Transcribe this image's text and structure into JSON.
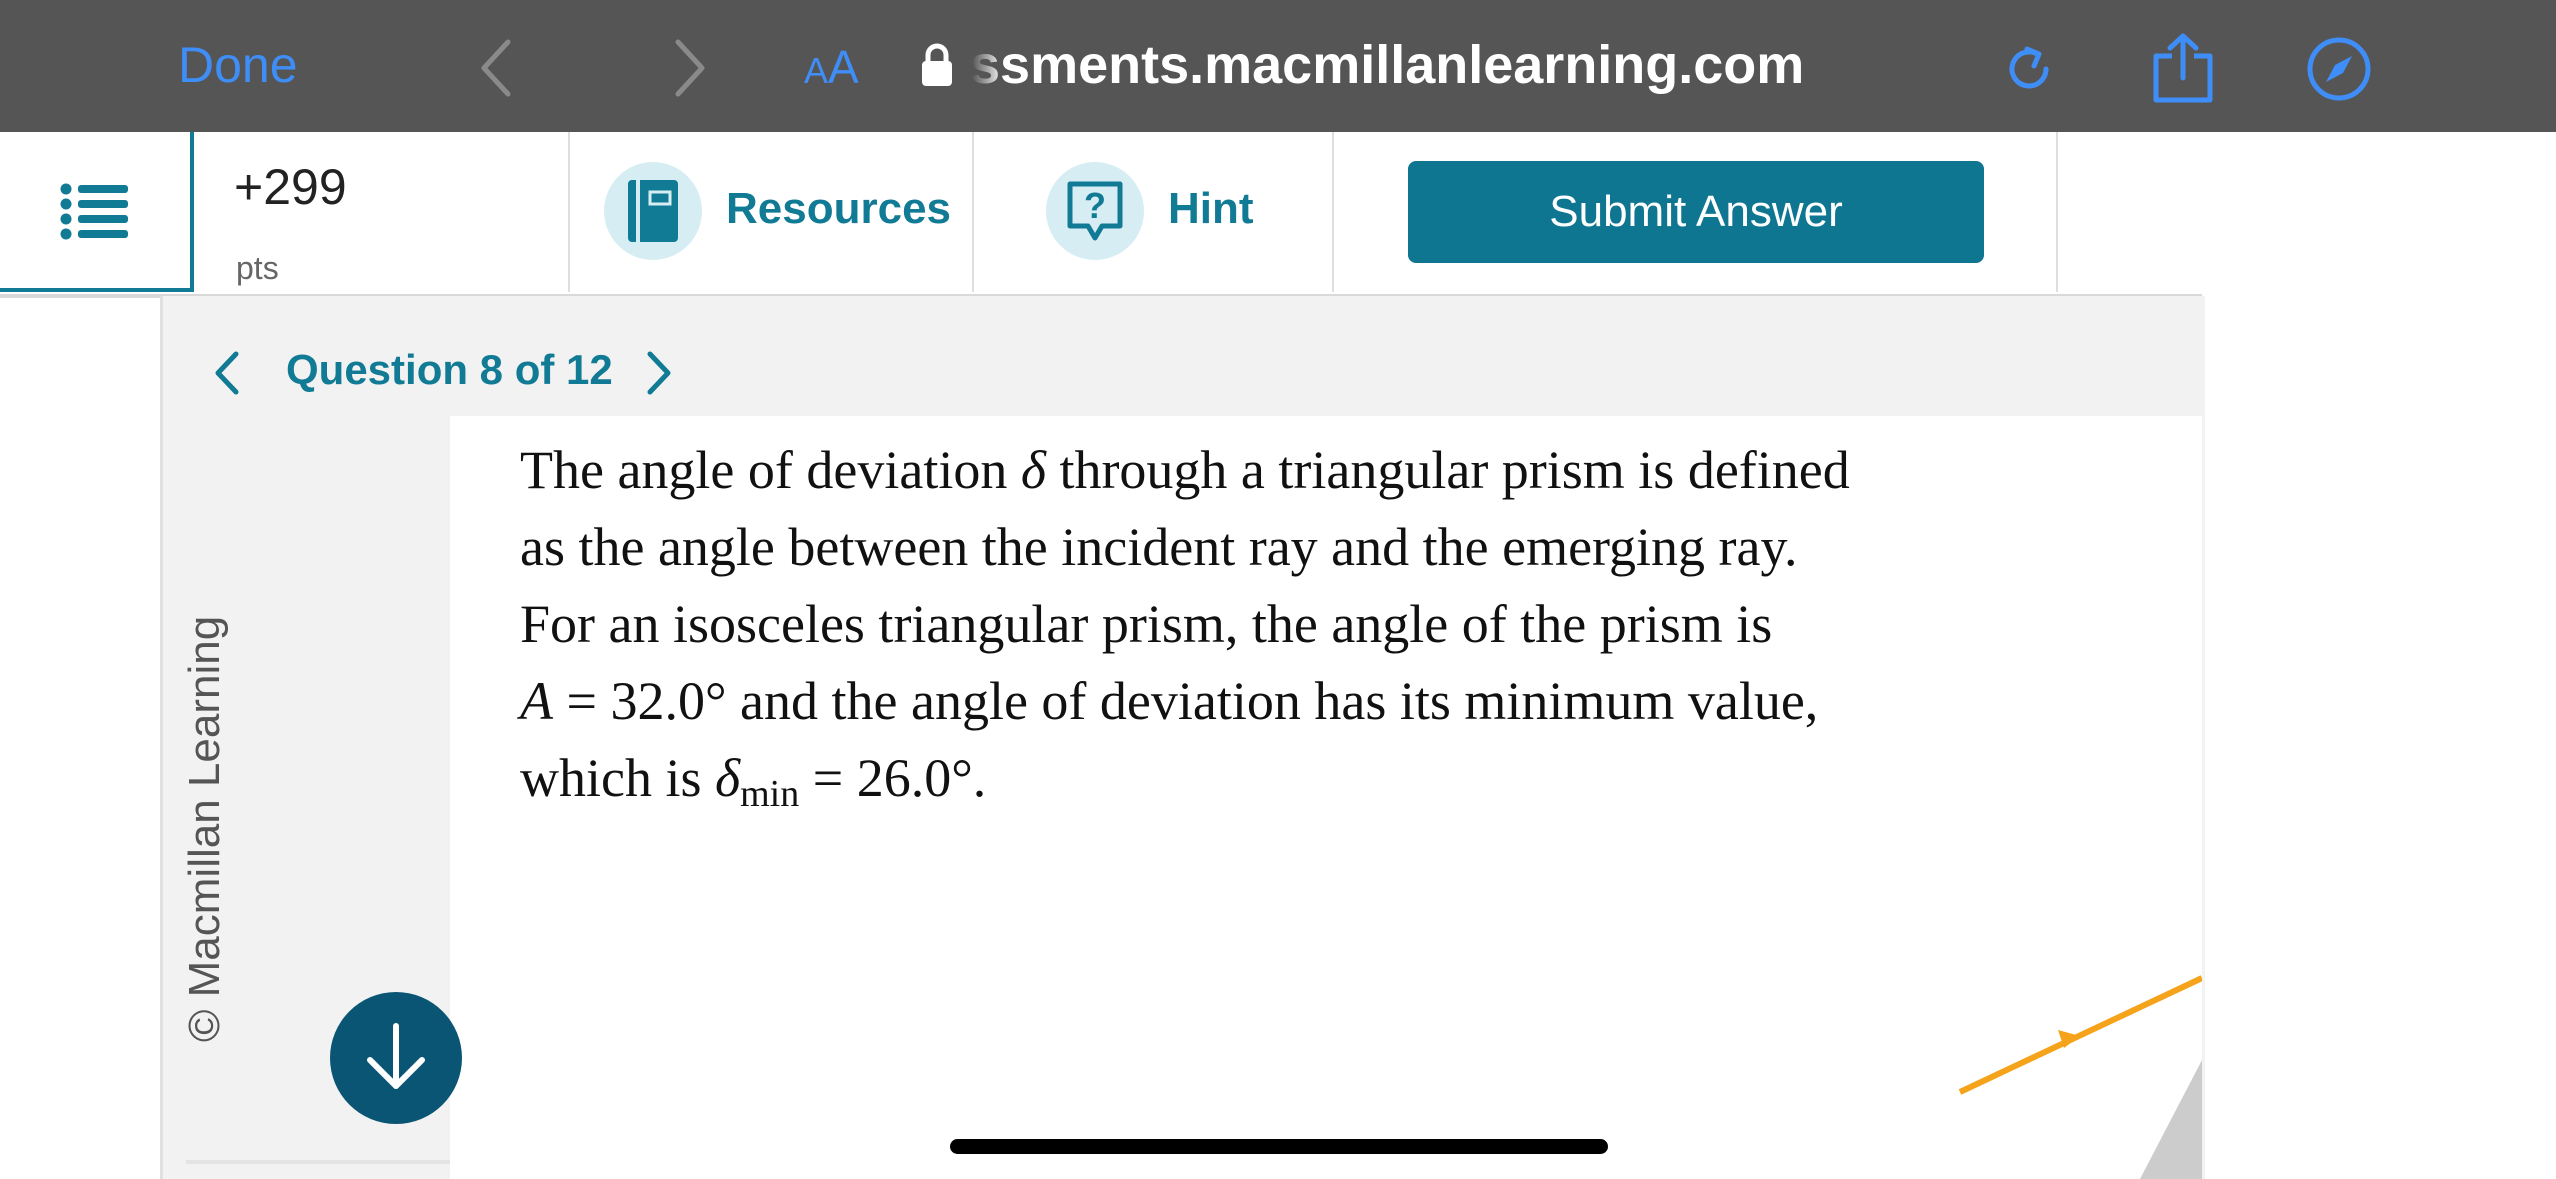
{
  "browser": {
    "done_label": "Done",
    "aa_small": "A",
    "aa_big": "A",
    "url": "ssments.macmillanlearning.com",
    "accent_color": "#3f8ef7",
    "icons": [
      "chevron-left-icon",
      "chevron-right-icon",
      "lock-icon",
      "reload-icon",
      "share-icon",
      "compass-icon"
    ]
  },
  "header": {
    "points_value": "+299",
    "points_unit": "pts",
    "resources_label": "Resources",
    "hint_label": "Hint",
    "submit_label": "Submit Answer",
    "brand_color": "#0f7691"
  },
  "question": {
    "nav_label": "Question 8 of 12",
    "text": {
      "l1_a": "The angle of deviation ",
      "l1_delta": "δ",
      "l1_b": " through a triangular prism is defined",
      "l2": "as the angle between the incident ray and the emerging ray.",
      "l3": "For an isosceles triangular prism, the angle of the prism is",
      "l4_var": "A",
      "l4_eq": " = 32.0° and the angle of deviation has its minimum value,",
      "l5_a": "which is ",
      "l5_delta": "δ",
      "l5_sub": "min",
      "l5_b": " = 26.0°."
    }
  },
  "sidebar": {
    "copyright": "© Macmillan Learning"
  }
}
